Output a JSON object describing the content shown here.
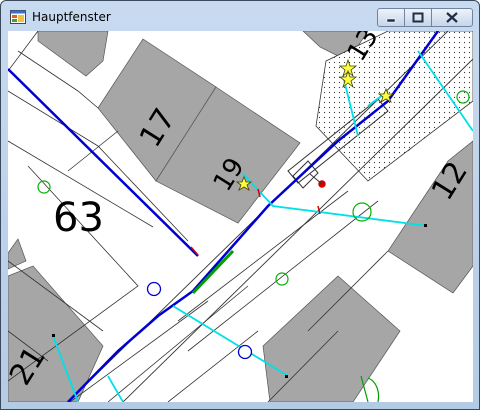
{
  "window": {
    "title": "Hauptfenster"
  },
  "map": {
    "house_numbers": {
      "n13": "13",
      "n17": "17",
      "n19": "19",
      "n12": "12",
      "n63": "63",
      "n21": "21"
    }
  },
  "colors": {
    "building_fill": "#a6a6a6",
    "main_line": "#0000d0",
    "service_line": "#00e0e8",
    "marker_star": "#ffff40",
    "valve_green": "#00a000"
  },
  "icons": {
    "minimize": "minimize-icon",
    "maximize": "maximize-icon",
    "close": "close-icon"
  }
}
